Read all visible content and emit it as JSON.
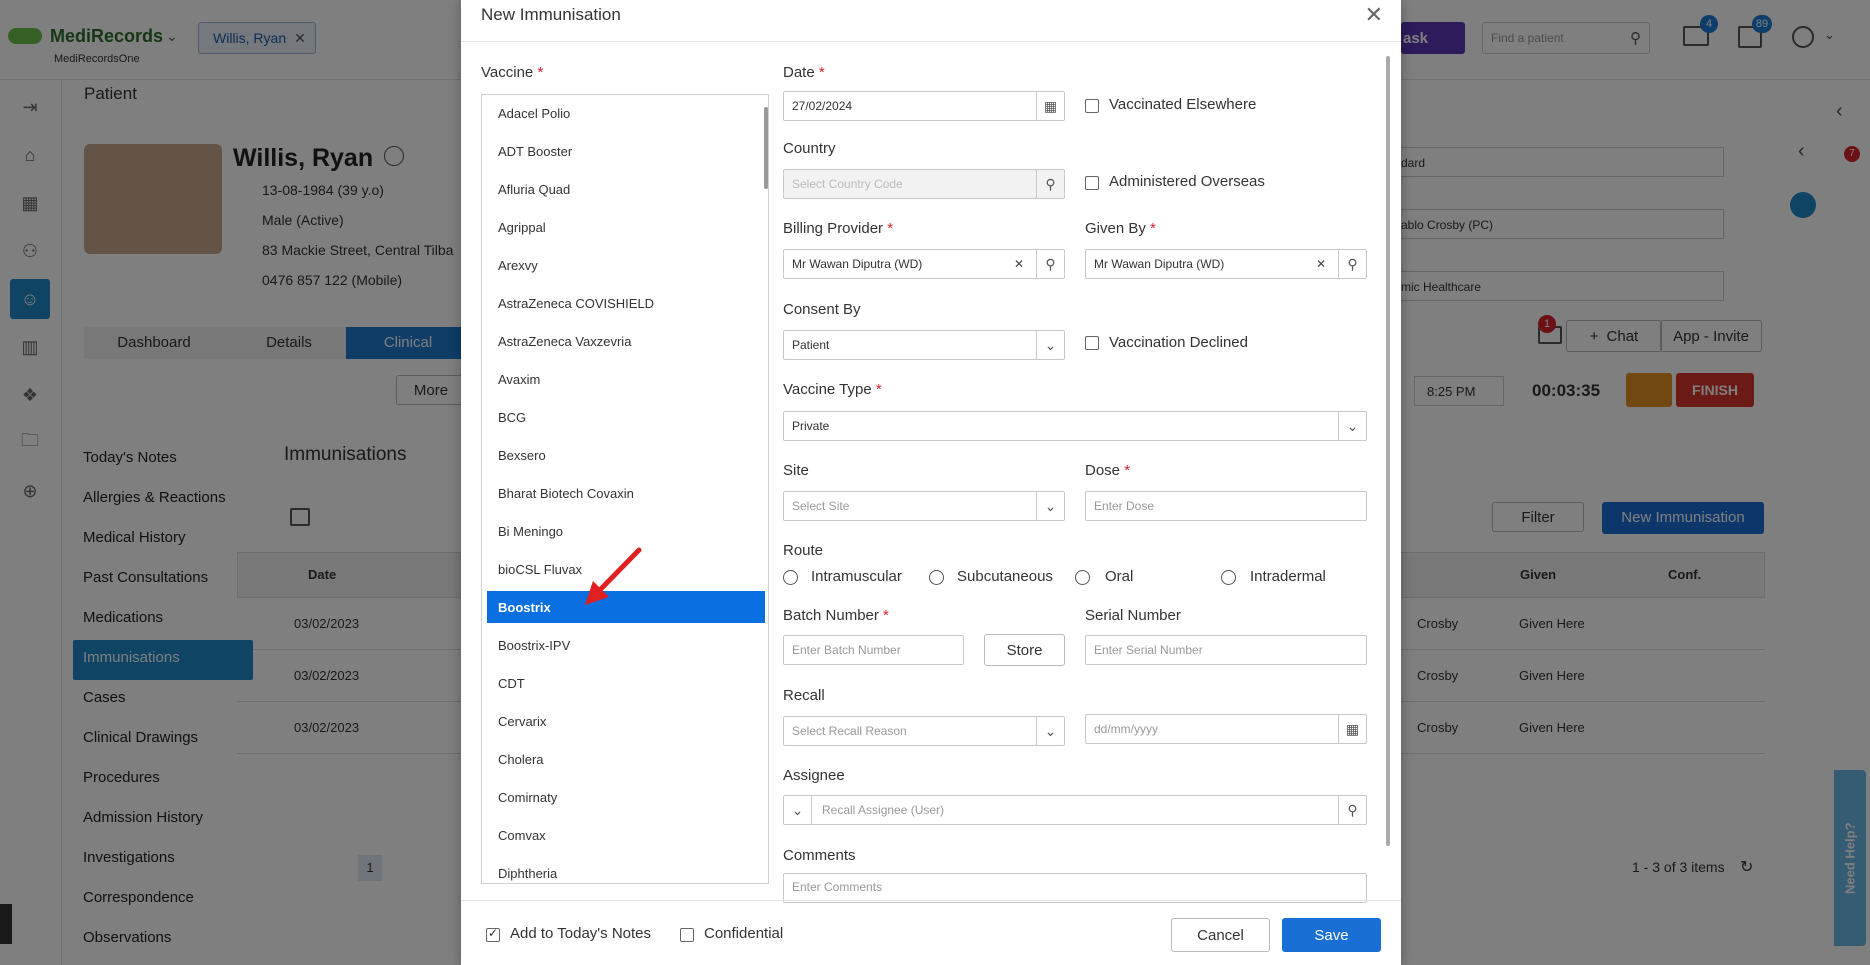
{
  "app": {
    "brand": "MediRecords",
    "brand_sub": "MediRecordsOne",
    "patient_tab": "Willis, Ryan",
    "task_label": "ask",
    "search_placeholder": "Find a patient",
    "mail_badge": "4",
    "tasks_badge": "89"
  },
  "patient": {
    "section_title": "Patient",
    "name": "Willis, Ryan",
    "dob": "13-08-1984 (39 y.o)",
    "gender": "Male (Active)",
    "address": "83 Mackie Street, Central Tilba",
    "phone": "0476 857 122 (Mobile)",
    "tabs": [
      "Dashboard",
      "Details",
      "Clinical"
    ],
    "more_label": "More",
    "right_fields": [
      "dard",
      "ablo Crosby (PC)",
      "mic Healthcare"
    ],
    "chat_label": "Chat",
    "app_invite_label": "App - Invite",
    "mail_badge": "1",
    "time_value": "8:25 PM",
    "timer": "00:03:35",
    "finish_label": "FINISH",
    "side_badge": "7"
  },
  "sidemenu": [
    "Today's Notes",
    "Allergies & Reactions",
    "Medical History",
    "Past Consultations",
    "Medications",
    "Immunisations",
    "Cases",
    "Clinical Drawings",
    "Procedures",
    "Admission History",
    "Investigations",
    "Correspondence",
    "Observations"
  ],
  "immunisations": {
    "title": "Immunisations",
    "filter_label": "Filter",
    "new_button": "New Immunisation",
    "columns": {
      "date": "Date",
      "given": "Given",
      "conf": "Conf."
    },
    "rows": [
      {
        "date": "03/02/2023",
        "by": "Crosby",
        "given": "Given Here"
      },
      {
        "date": "03/02/2023",
        "by": "Crosby",
        "given": "Given Here"
      },
      {
        "date": "03/02/2023",
        "by": "Crosby",
        "given": "Given Here"
      }
    ],
    "page": "1",
    "items_count": "1 - 3 of 3 items"
  },
  "help_tab": "Need Help?",
  "modal": {
    "title": "New Immunisation",
    "vaccine_label": "Vaccine",
    "vaccines": [
      "Adacel Polio",
      "ADT Booster",
      "Afluria Quad",
      "Agrippal",
      "Arexvy",
      "AstraZeneca COVISHIELD",
      "AstraZeneca Vaxzevria",
      "Avaxim",
      "BCG",
      "Bexsero",
      "Bharat Biotech Covaxin",
      "Bi Meningo",
      "bioCSL Fluvax",
      "Boostrix",
      "Boostrix-IPV",
      "CDT",
      "Cervarix",
      "Cholera",
      "Comirnaty",
      "Comvax",
      "Diphtheria"
    ],
    "selected_vaccine": "Boostrix",
    "date_label": "Date",
    "date_value": "27/02/2024",
    "vaccinated_elsewhere": "Vaccinated Elsewhere",
    "country_label": "Country",
    "country_placeholder": "Select Country Code",
    "administered_overseas": "Administered Overseas",
    "billing_provider_label": "Billing Provider",
    "billing_provider_value": "Mr Wawan Diputra (WD)",
    "given_by_label": "Given By",
    "given_by_value": "Mr Wawan Diputra (WD)",
    "consent_by_label": "Consent By",
    "consent_by_value": "Patient",
    "vaccination_declined": "Vaccination Declined",
    "vaccine_type_label": "Vaccine Type",
    "vaccine_type_value": "Private",
    "site_label": "Site",
    "site_placeholder": "Select Site",
    "dose_label": "Dose",
    "dose_placeholder": "Enter Dose",
    "route_label": "Route",
    "routes": [
      "Intramuscular",
      "Subcutaneous",
      "Oral",
      "Intradermal"
    ],
    "batch_label": "Batch Number",
    "batch_placeholder": "Enter Batch Number",
    "store_label": "Store",
    "serial_label": "Serial Number",
    "serial_placeholder": "Enter Serial Number",
    "recall_label": "Recall",
    "recall_placeholder": "Select Recall Reason",
    "recall_date_placeholder": "dd/mm/yyyy",
    "assignee_label": "Assignee",
    "assignee_placeholder": "Recall Assignee (User)",
    "comments_label": "Comments",
    "comments_placeholder": "Enter Comments",
    "add_to_notes": "Add to Today's Notes",
    "confidential": "Confidential",
    "cancel": "Cancel",
    "save": "Save"
  }
}
